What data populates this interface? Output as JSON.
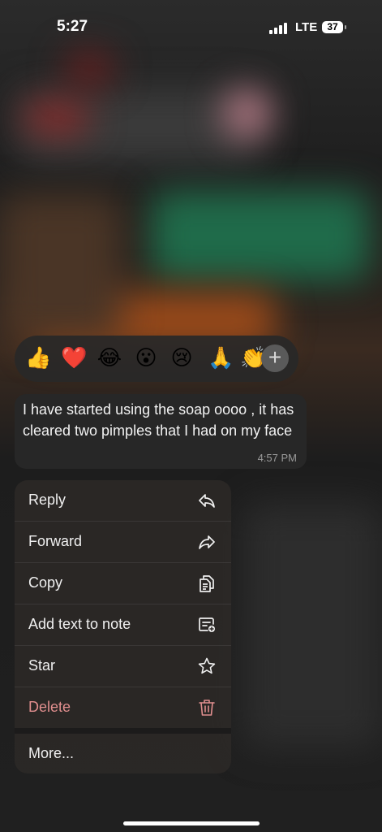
{
  "status_bar": {
    "time": "5:27",
    "network": "LTE",
    "battery": "37"
  },
  "reactions": {
    "emojis": [
      "👍",
      "❤️",
      "😂",
      "😮",
      "😢",
      "🙏",
      "👏"
    ],
    "icons": [
      "thumbs-up",
      "red-heart",
      "tears-of-joy",
      "surprised",
      "crying",
      "folded-hands",
      "clapping-hands"
    ],
    "add_label": "+"
  },
  "message": {
    "text": "I have started using the soap oooo , it has cleared two pimples that I had on my face",
    "time": "4:57 PM"
  },
  "menu": {
    "items": [
      {
        "label": "Reply",
        "icon": "reply-icon"
      },
      {
        "label": "Forward",
        "icon": "forward-icon"
      },
      {
        "label": "Copy",
        "icon": "copy-icon"
      },
      {
        "label": "Add text to note",
        "icon": "note-add-icon"
      },
      {
        "label": "Star",
        "icon": "star-icon"
      },
      {
        "label": "Delete",
        "icon": "trash-icon"
      },
      {
        "label": "More...",
        "icon": ""
      }
    ],
    "colors": {
      "text": "#f0f0f0",
      "danger": "#e08e8e"
    }
  }
}
